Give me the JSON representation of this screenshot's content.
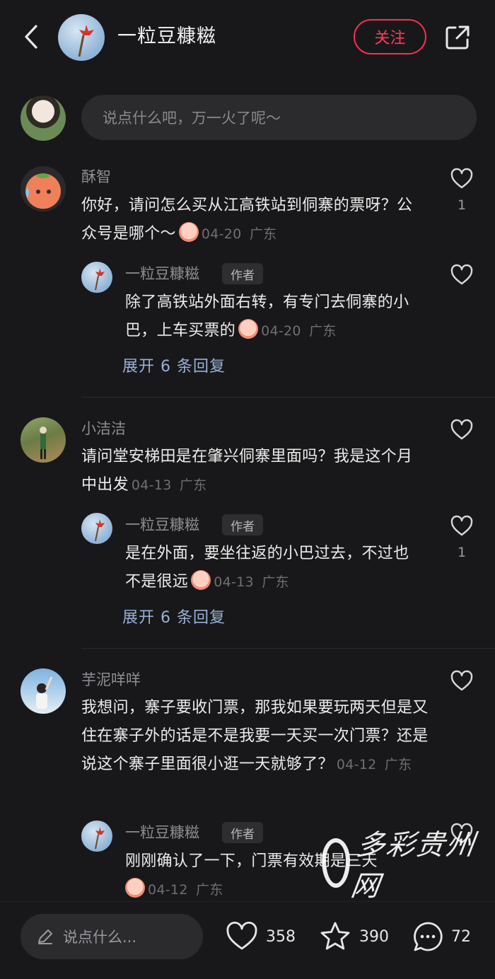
{
  "header": {
    "title": "一粒豆糠糍",
    "follow_label": "关注"
  },
  "comment_input": {
    "placeholder": "说点什么吧，万一火了呢～"
  },
  "comments": [
    {
      "user": "酥智",
      "text": "你好，请问怎么买从江高铁站到侗寨的票呀？公众号是哪个～",
      "date": "04-20",
      "location": "广东",
      "likes": "1",
      "reply": {
        "user": "一粒豆糠糍",
        "badge": "作者",
        "text": "除了高铁站外面右转，有专门去侗寨的小巴，上车买票的",
        "date": "04-20",
        "location": "广东",
        "likes": ""
      },
      "expand_label": "展开 6 条回复"
    },
    {
      "user": "小洁洁",
      "text": "请问堂安梯田是在肇兴侗寨里面吗？我是这个月中出发",
      "date": "04-13",
      "location": "广东",
      "likes": "",
      "reply": {
        "user": "一粒豆糠糍",
        "badge": "作者",
        "text": "是在外面，要坐往返的小巴过去，不过也不是很远",
        "date": "04-13",
        "location": "广东",
        "likes": "1"
      },
      "expand_label": "展开 6 条回复"
    },
    {
      "user": "芋泥咩咩",
      "text": "我想问，寨子要收门票，那我如果要玩两天但是又住在寨子外的话是不是我要一天买一次门票？还是说这个寨子里面很小逛一天就够了？",
      "date": "04-12",
      "location": "广东",
      "likes": "",
      "reply": {
        "user": "一粒豆糠糍",
        "badge": "作者",
        "text": "刚刚确认了一下，门票有效期是三天",
        "date": "04-12",
        "location": "广东",
        "likes": ""
      }
    }
  ],
  "bottom_bar": {
    "say_placeholder": "说点什么...",
    "likes": "358",
    "stars": "390",
    "comments": "72"
  },
  "watermark": {
    "text": "多彩贵州网"
  }
}
